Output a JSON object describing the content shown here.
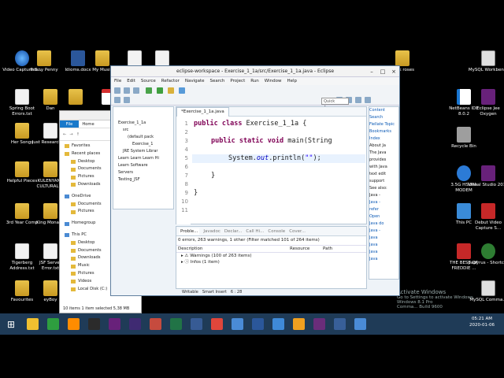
{
  "desktop": {
    "left_icons": [
      {
        "label": "Video Capture S...",
        "glyph": "globe"
      },
      {
        "label": "Penny Penny",
        "glyph": "folder"
      },
      {
        "label": "Idioms.docx",
        "glyph": "word"
      },
      {
        "label": "My Music",
        "glyph": "folder"
      },
      {
        "label": "",
        "glyph": "file"
      },
      {
        "label": "",
        "glyph": "file"
      },
      {
        "label": "Spring Boot Errors.txt",
        "glyph": "file"
      },
      {
        "label": "Dan",
        "glyph": "folder"
      },
      {
        "label": "",
        "glyph": "folder"
      },
      {
        "label": "",
        "glyph": "pdf"
      },
      {
        "label": "Her Songs",
        "glyph": "folder"
      },
      {
        "label": "Just Research.txt",
        "glyph": "file"
      },
      {
        "label": "Helpful Pieces",
        "glyph": "folder"
      },
      {
        "label": "KULENYANA CULTURAL ...",
        "glyph": "folder"
      },
      {
        "label": "3rd Year Comp",
        "glyph": "folder"
      },
      {
        "label": "King Monada",
        "glyph": "folder"
      },
      {
        "label": "Tigerberg Address.txt",
        "glyph": "file"
      },
      {
        "label": "JSF Server Error.txt",
        "glyph": "file"
      },
      {
        "label": "Favourites",
        "glyph": "folder"
      },
      {
        "label": "eyBoy",
        "glyph": "folder"
      }
    ],
    "right_icons": [
      {
        "label": "Book roses",
        "glyph": "folder"
      },
      {
        "label": "MySQL Workben...",
        "glyph": "sql"
      },
      {
        "label": "NetBeans IDE 8.0.2",
        "glyph": "java"
      },
      {
        "label": "Eclipse Jee Oxygen",
        "glyph": "vs"
      },
      {
        "label": "Recycle Bin",
        "glyph": "gray"
      },
      {
        "label": "3.5G HSUPA MODEM",
        "glyph": "blue"
      },
      {
        "label": "Visual Studio 2017",
        "glyph": "vs"
      },
      {
        "label": "This PC",
        "glyph": "pc"
      },
      {
        "label": "Debut Video Capture S...",
        "glyph": "red"
      },
      {
        "label": "THE BEST OF FREDDIE ...",
        "glyph": "red"
      },
      {
        "label": "papyrus - Shortcut",
        "glyph": "green"
      },
      {
        "label": "MySQL Comma...",
        "glyph": "sql"
      }
    ],
    "windows_watermark": "Activate Windows",
    "watermark_sub": "Go to Settings to activate Windows.",
    "build_fragment": "Comma... Build 9600",
    "windows_version": "Windows 8.1 Pro"
  },
  "explorer": {
    "tabs": [
      "File",
      "Home"
    ],
    "favorites_label": "Favorites",
    "items": [
      "Recent places",
      "Desktop",
      "Documents",
      "Pictures",
      "Downloads",
      "OneDrive",
      "Documents",
      "Pictures",
      "Homegroup",
      "This PC",
      "Desktop",
      "Documents",
      "Downloads",
      "Music",
      "Pictures",
      "Videos",
      "Local Disk (C:)"
    ],
    "status": "10 items    1 item selected  5,38 MB"
  },
  "eclipse": {
    "title": "eclipse-workspace - Exercise_1_1a/src/Exercise_1_1a.java - Eclipse",
    "menus": [
      "File",
      "Edit",
      "Source",
      "Refactor",
      "Navigate",
      "Search",
      "Project",
      "Run",
      "Window",
      "Help"
    ],
    "quick_access": "Quick Access",
    "package_tree": [
      "Exercise_1_1a",
      "src",
      "(default pack",
      "Exercise_1",
      "JRE System Librar",
      "Learn Learn Learn Hi",
      "Learn Software",
      "Servers",
      "Testing_JSF"
    ],
    "editor_tab": "*Exercise_1_1a.java",
    "code_lines": [
      {
        "num": "1",
        "text": "public class Exercise_1_1a {"
      },
      {
        "num": "2",
        "text": ""
      },
      {
        "num": "3",
        "text": "    public static void main(String"
      },
      {
        "num": "4",
        "text": ""
      },
      {
        "num": "5",
        "text": "        System.out.println(\"\");"
      },
      {
        "num": "6",
        "text": ""
      },
      {
        "num": "7",
        "text": "    }"
      },
      {
        "num": "8",
        "text": ""
      },
      {
        "num": "9",
        "text": "}"
      },
      {
        "num": "10",
        "text": ""
      },
      {
        "num": "11",
        "text": ""
      }
    ],
    "code_parts": {
      "kw_public": "public",
      "kw_class": "class",
      "class_name": " Exercise_1_1a {",
      "kw_public2": "public",
      "kw_static": "static",
      "kw_void": "void",
      "main_rest": " main(String",
      "system": "System.",
      "out": "out",
      "println": ".println(",
      "string": "\"\"",
      "end": ");",
      "close_method": "}",
      "close_class": "}"
    },
    "right_panel": [
      "Content",
      "Search",
      "Fiellate Topic",
      "Bookmarks",
      "Index",
      "About Ja",
      "The Java",
      "provides",
      "with Java",
      "text edit",
      "support",
      "See also:",
      "Java -",
      "Java -",
      "refer",
      "Open",
      "Java do",
      "Java -",
      "Java",
      "Java",
      "Java",
      "Java"
    ],
    "bottom_tabs": [
      "Proble...",
      "Javadoc",
      "Declar...",
      "Call Hi...",
      "Console",
      "Cover..."
    ],
    "problems_summary": "0 errors, 263 warnings, 1 other (Filter matched 101 of 264 items)",
    "columns": [
      "Description",
      "Resource",
      "Path"
    ],
    "problem_rows": [
      "Warnings (100 of 263 items)",
      "Infos (1 item)"
    ],
    "status": [
      "Writable",
      "Smart Insert",
      "6 : 28"
    ]
  },
  "taskbar": {
    "apps": [
      {
        "name": "explorer",
        "color": "#f0c030"
      },
      {
        "name": "browser-green",
        "color": "#2e9e3f"
      },
      {
        "name": "vlc",
        "color": "#ff8c00"
      },
      {
        "name": "terminal",
        "color": "#2b2b2b"
      },
      {
        "name": "visual-studio",
        "color": "#68217a"
      },
      {
        "name": "eclipse",
        "color": "#3f2a72"
      },
      {
        "name": "git",
        "color": "#c64b3e"
      },
      {
        "name": "excel",
        "color": "#217346"
      },
      {
        "name": "tools",
        "color": "#375b94"
      },
      {
        "name": "chrome",
        "color": "#e0463b"
      },
      {
        "name": "paint",
        "color": "#4a8bd6"
      },
      {
        "name": "word",
        "color": "#2b579a"
      },
      {
        "name": "box",
        "color": "#3f8ad8"
      },
      {
        "name": "cube",
        "color": "#f0a020"
      },
      {
        "name": "media",
        "color": "#6a2d7a"
      },
      {
        "name": "network",
        "color": "#385f98"
      },
      {
        "name": "monitor",
        "color": "#4a8bd6"
      }
    ],
    "time": "05:21 AM",
    "date": "2020-01-06"
  }
}
